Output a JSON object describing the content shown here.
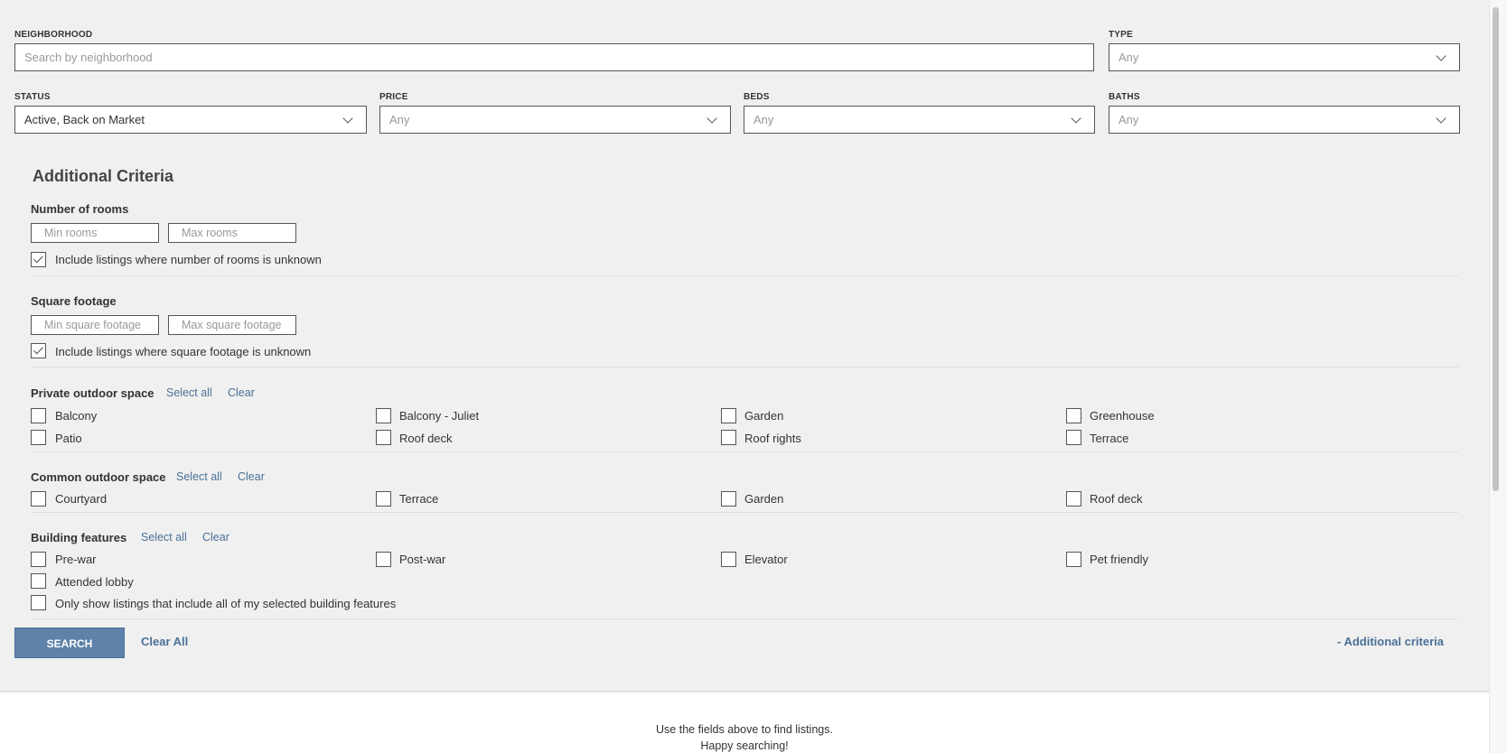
{
  "top": {
    "neighborhood": {
      "label": "NEIGHBORHOOD",
      "placeholder": "Search by neighborhood"
    },
    "type": {
      "label": "TYPE",
      "value": "Any"
    },
    "status": {
      "label": "STATUS",
      "value": "Active, Back on Market"
    },
    "price": {
      "label": "PRICE",
      "value": "Any"
    },
    "beds": {
      "label": "BEDS",
      "value": "Any"
    },
    "baths": {
      "label": "BATHS",
      "value": "Any"
    }
  },
  "additional": {
    "title": "Additional Criteria",
    "rooms": {
      "label": "Number of rooms",
      "min_placeholder": "Min rooms",
      "max_placeholder": "Max rooms",
      "unknown_label": "Include listings where number of rooms is unknown",
      "unknown_checked": true
    },
    "sqft": {
      "label": "Square footage",
      "min_placeholder": "Min square footage",
      "max_placeholder": "Max square footage",
      "unknown_label": "Include listings where square footage is unknown",
      "unknown_checked": true
    },
    "private_outdoor": {
      "label": "Private outdoor space",
      "select_all": "Select all",
      "clear": "Clear",
      "options": [
        "Balcony",
        "Balcony - Juliet",
        "Garden",
        "Greenhouse",
        "Patio",
        "Roof deck",
        "Roof rights",
        "Terrace"
      ]
    },
    "common_outdoor": {
      "label": "Common outdoor space",
      "select_all": "Select all",
      "clear": "Clear",
      "options": [
        "Courtyard",
        "Terrace",
        "Garden",
        "Roof deck"
      ]
    },
    "building": {
      "label": "Building features",
      "select_all": "Select all",
      "clear": "Clear",
      "options": [
        "Pre-war",
        "Post-war",
        "Elevator",
        "Pet friendly",
        "Attended lobby"
      ],
      "only_all_label": "Only show listings that include all of my selected building features"
    }
  },
  "actions": {
    "search": "SEARCH",
    "clear_all": "Clear All",
    "toggle_additional": "- Additional criteria"
  },
  "results": {
    "line1": "Use the fields above to find listings.",
    "line2": "Happy searching!"
  }
}
